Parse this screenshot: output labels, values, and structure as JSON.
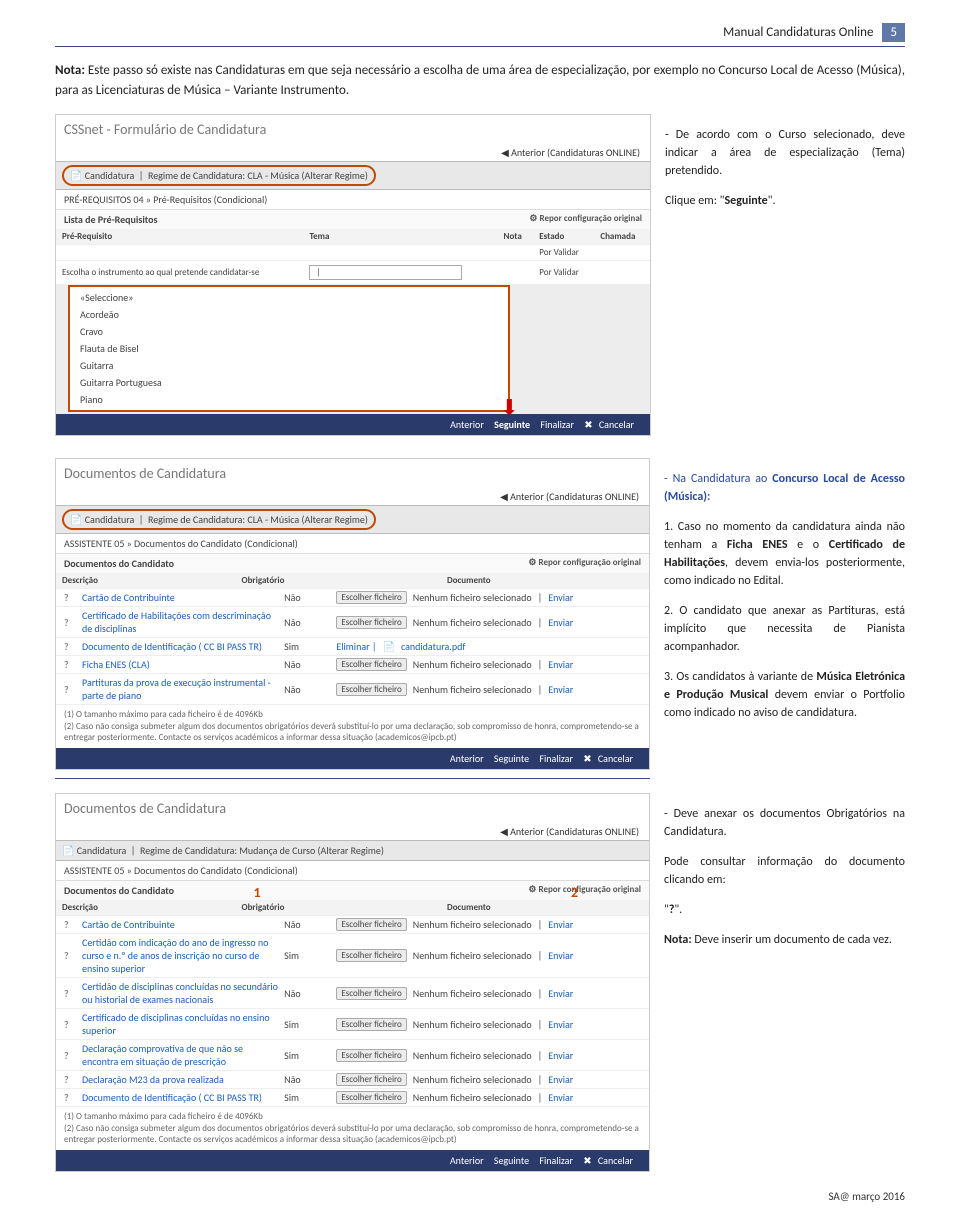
{
  "header": {
    "title": "Manual Candidaturas Online",
    "page": "5"
  },
  "nota1": {
    "label": "Nota:",
    "text": " Este passo só existe nas Candidaturas em que seja necessário a escolha de uma área de especialização, por exemplo no Concurso Local de Acesso (Música), para as Licenciaturas de Música – Variante Instrumento."
  },
  "shot1": {
    "title": "CSSnet - Formulário de Candidatura",
    "prev": "Anterior (Candidaturas ONLINE)",
    "cand": "Candidatura",
    "regime": "Regime de Candidatura: CLA - Música (Alterar Regime)",
    "crumb": "PRÉ-REQUISITOS 04 » Pré-Requisitos (Condicional)",
    "list": "Lista de Pré-Requisitos",
    "repor": "Repor configuração original",
    "h": [
      "Pré-Requisito",
      "Tema",
      "Nota",
      "Estado",
      "Chamada"
    ],
    "escolha": "Escolha o instrumento ao qual pretende candidatar-se",
    "opts": [
      "«Seleccione»",
      "Acordeão",
      "Cravo",
      "Flauta de Bisel",
      "Guitarra",
      "Guitarra Portuguesa",
      "Piano"
    ],
    "estados": [
      "Por Validar",
      "Por Validar"
    ],
    "bar": [
      "Anterior",
      "Seguinte",
      "Finalizar",
      "Cancelar"
    ]
  },
  "side1": {
    "l1": "- De acordo com o Curso selecionado, deve indicar a área de especialização (Tema) pretendido.",
    "l2": "Clique em: \"",
    "l2b": "Seguinte",
    "l2c": "\"."
  },
  "shot2": {
    "title": "Documentos de Candidatura",
    "prev": "Anterior (Candidaturas ONLINE)",
    "cand": "Candidatura",
    "regime": "Regime de Candidatura: CLA - Música (Alterar Regime)",
    "crumb": "ASSISTENTE 05 » Documentos do Candidato (Condicional)",
    "sect": "Documentos do Candidato",
    "repor": "Repor configuração original",
    "h": [
      "Descrição",
      "Obrigatório",
      "Documento"
    ],
    "rows": [
      {
        "d": "Cartão de Contribuinte",
        "o": "Não",
        "doc": "Nenhum ficheiro selecionado",
        "env": "Enviar",
        "btn": "Escolher ficheiro"
      },
      {
        "d": "Certificado de Habilitações com descriminação de disciplinas",
        "o": "Não",
        "doc": "Nenhum ficheiro selecionado",
        "env": "Enviar",
        "btn": "Escolher ficheiro"
      },
      {
        "d": "Documento de Identificação ( CC BI PASS TR)",
        "o": "Sim",
        "doc": "candidatura.pdf",
        "elim": "Eliminar |"
      },
      {
        "d": "Ficha ENES (CLA)",
        "o": "Não",
        "doc": "Nenhum ficheiro selecionado",
        "env": "Enviar",
        "btn": "Escolher ficheiro"
      },
      {
        "d": "Partituras da prova de execução instrumental - parte de piano",
        "o": "Não",
        "doc": "Nenhum ficheiro selecionado",
        "env": "Enviar",
        "btn": "Escolher ficheiro"
      }
    ],
    "foot1": "(1) O tamanho máximo para cada ficheiro é de 4096Kb",
    "foot2": "(2) Caso não consiga submeter algum dos documentos obrigatórios deverá substituí-lo por uma declaração, sob compromisso de honra, comprometendo-se a entregar posteriormente. Contacte os serviços académicos a informar dessa situação (academicos@ipcb.pt)",
    "bar": [
      "Anterior",
      "Seguinte",
      "Finalizar",
      "Cancelar"
    ]
  },
  "side2": {
    "h": "- Na Candidatura ao ",
    "hb": "Concurso Local de Acesso (Música):",
    "p1": "1. Caso no momento da candidatura ainda não tenham a ",
    "p1b": "Ficha ENES",
    "p1c": " e o ",
    "p1d": "Certificado de Habilitações",
    "p1e": ", devem envia-los posteriormente, como indicado no Edital.",
    "p2": "2. O candidato que anexar as Partituras, está implícito que necessita de Pianista acompanhador.",
    "p3a": "3. Os candidatos à variante de ",
    "p3b": "Música Eletrónica e Produção Musical ",
    "p3c": "devem enviar o Portfolio como indicado no aviso de candidatura."
  },
  "shot3": {
    "title": "Documentos de Candidatura",
    "prev": "Anterior (Candidaturas ONLINE)",
    "cand": "Candidatura",
    "regime": "Regime de Candidatura: Mudança de Curso (Alterar Regime)",
    "crumb": "ASSISTENTE 05 » Documentos do Candidato (Condicional)",
    "sect": "Documentos do Candidato",
    "repor": "Repor configuração original",
    "h": [
      "Descrição",
      "Obrigatório",
      "Documento"
    ],
    "rows": [
      {
        "d": "Cartão de Contribuinte",
        "o": "Não"
      },
      {
        "d": "Certidão com indicação do ano de ingresso no curso e n.º de anos de inscrição no curso de ensino superior",
        "o": "Sim"
      },
      {
        "d": "Certidão de disciplinas concluídas no secundário ou historial de exames nacionais",
        "o": "Não"
      },
      {
        "d": "Certificado de disciplinas concluídas no ensino superior",
        "o": "Sim"
      },
      {
        "d": "Declaração comprovativa de que não se encontra em situação de prescrição",
        "o": "Sim"
      },
      {
        "d": "Declaração M23 da prova realizada",
        "o": "Não"
      },
      {
        "d": "Documento de Identificação ( CC BI PASS TR)",
        "o": "Sim"
      }
    ],
    "docbtn": "Escolher ficheiro",
    "docnone": "Nenhum ficheiro selecionado",
    "env": "Enviar",
    "foot1": "(1) O tamanho máximo para cada ficheiro é de 4096Kb",
    "foot2": "(2) Caso não consiga submeter algum dos documentos obrigatórios deverá substituí-lo por uma declaração, sob compromisso de honra, comprometendo-se a entregar posteriormente. Contacte os serviços académicos a informar dessa situação (academicos@ipcb.pt)",
    "bar": [
      "Anterior",
      "Seguinte",
      "Finalizar",
      "Cancelar"
    ],
    "num1": "1",
    "num2": "2"
  },
  "side3": {
    "l1": "- Deve anexar os documentos Obrigatórios na Candidatura.",
    "l2": "Pode consultar informação do documento clicando em:",
    "l3": "\"",
    "l3b": "?",
    "l3c": "\".",
    "l4a": "Nota:",
    "l4b": " Deve inserir um documento de cada vez."
  },
  "footer": "SA@ março 2016"
}
